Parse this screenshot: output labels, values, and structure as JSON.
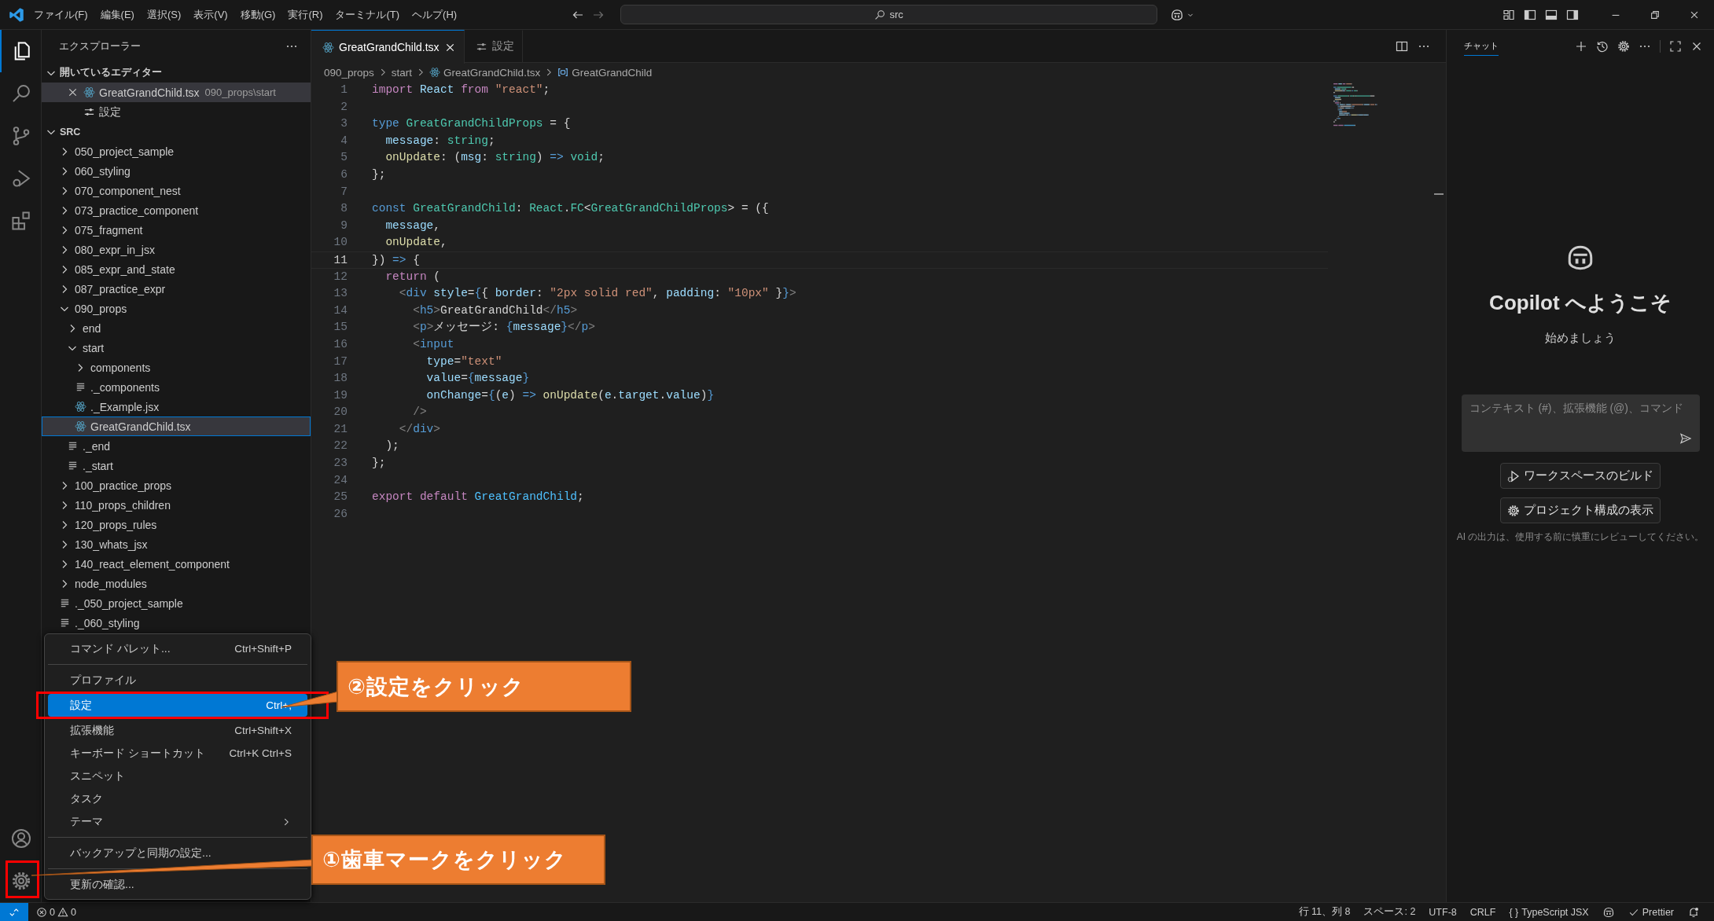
{
  "title_bar": {
    "menus": [
      "ファイル(F)",
      "編集(E)",
      "選択(S)",
      "表示(V)",
      "移動(G)",
      "実行(R)",
      "ターミナル(T)",
      "ヘルプ(H)"
    ],
    "search": {
      "value": "src"
    }
  },
  "activity_bar": {
    "top": [
      {
        "kind": "explorer",
        "selected": true
      },
      {
        "kind": "search",
        "selected": false
      },
      {
        "kind": "source-control",
        "selected": false
      },
      {
        "kind": "run-debug",
        "selected": false
      },
      {
        "kind": "extensions",
        "selected": false
      }
    ],
    "bottom": [
      {
        "kind": "account"
      },
      {
        "kind": "settings"
      }
    ]
  },
  "explorer": {
    "title": "エクスプローラー",
    "sections": [
      {
        "label": "開いているエディター",
        "expanded": true,
        "items": [
          {
            "label": "GreatGrandChild.tsx",
            "description": "090_props\\start",
            "kind": "react",
            "selected": true
          },
          {
            "label": "設定",
            "kind": "settings",
            "selected": false
          }
        ]
      },
      {
        "label": "SRC",
        "expanded": true,
        "items": [
          {
            "label": "050_project_sample",
            "kind": "folder",
            "expanded": false,
            "selected": false
          },
          {
            "label": "060_styling",
            "kind": "folder",
            "expanded": false,
            "selected": false
          },
          {
            "label": "070_component_nest",
            "kind": "folder",
            "expanded": false,
            "selected": false
          },
          {
            "label": "073_practice_component",
            "kind": "folder",
            "expanded": false,
            "selected": false
          },
          {
            "label": "075_fragment",
            "kind": "folder",
            "expanded": false,
            "selected": false
          },
          {
            "label": "080_expr_in_jsx",
            "kind": "folder",
            "expanded": false,
            "selected": false
          },
          {
            "label": "085_expr_and_state",
            "kind": "folder",
            "expanded": false,
            "selected": false
          },
          {
            "label": "087_practice_expr",
            "kind": "folder",
            "expanded": false,
            "selected": false
          },
          {
            "label": "090_props",
            "kind": "folder",
            "expanded": true,
            "selected": false,
            "children": [
              {
                "label": "end",
                "kind": "folder",
                "expanded": false,
                "selected": false
              },
              {
                "label": "start",
                "kind": "folder",
                "expanded": true,
                "selected": false,
                "children": [
                  {
                    "label": "components",
                    "kind": "folder",
                    "expanded": false,
                    "selected": false
                  },
                  {
                    "label": "._components",
                    "kind": "text",
                    "selected": false
                  },
                  {
                    "label": "._Example.jsx",
                    "kind": "react",
                    "selected": false
                  },
                  {
                    "label": "GreatGrandChild.tsx",
                    "kind": "react",
                    "selected": true
                  }
                ]
              },
              {
                "label": "._end",
                "kind": "text",
                "selected": false
              },
              {
                "label": "._start",
                "kind": "text",
                "selected": false
              }
            ]
          },
          {
            "label": "100_practice_props",
            "kind": "folder",
            "expanded": false,
            "selected": false
          },
          {
            "label": "110_props_children",
            "kind": "folder",
            "expanded": false,
            "selected": false
          },
          {
            "label": "120_props_rules",
            "kind": "folder",
            "expanded": false,
            "selected": false
          },
          {
            "label": "130_whats_jsx",
            "kind": "folder",
            "expanded": false,
            "selected": false
          },
          {
            "label": "140_react_element_component",
            "kind": "folder",
            "expanded": false,
            "selected": false
          },
          {
            "label": "node_modules",
            "kind": "folder",
            "expanded": false,
            "selected": false
          },
          {
            "label": "._050_project_sample",
            "kind": "text",
            "selected": false
          },
          {
            "label": "._060_styling",
            "kind": "text",
            "selected": false
          }
        ]
      }
    ]
  },
  "editor": {
    "tabs": [
      {
        "label": "GreatGrandChild.tsx",
        "kind": "react",
        "selected": true
      },
      {
        "label": "設定",
        "kind": "settings",
        "selected": false
      }
    ],
    "breadcrumb": [
      {
        "label": "090_props",
        "kind": "folder"
      },
      {
        "label": "start",
        "kind": "folder"
      },
      {
        "label": "GreatGrandChild.tsx",
        "kind": "react"
      },
      {
        "label": "GreatGrandChild",
        "kind": "symbol"
      }
    ],
    "lines": [
      {
        "number": "1",
        "current": false,
        "tokens": [
          {
            "kind": "keyword",
            "text": "import "
          },
          {
            "kind": "variable",
            "text": "React "
          },
          {
            "kind": "keyword",
            "text": "from "
          },
          {
            "kind": "string",
            "text": "\"react\""
          },
          {
            "kind": "plain",
            "text": ";"
          }
        ]
      },
      {
        "number": "2",
        "current": false
      },
      {
        "number": "3",
        "current": false,
        "tokens": [
          {
            "kind": "storage",
            "text": "type "
          },
          {
            "kind": "type",
            "text": "GreatGrandChildProps "
          },
          {
            "kind": "plain",
            "text": "= {"
          }
        ]
      },
      {
        "number": "4",
        "current": false,
        "tokens": [
          {
            "kind": "variable",
            "text": "  message"
          },
          {
            "kind": "plain",
            "text": ": "
          },
          {
            "kind": "type",
            "text": "string"
          },
          {
            "kind": "plain",
            "text": ";"
          }
        ]
      },
      {
        "number": "5",
        "current": false,
        "tokens": [
          {
            "kind": "function",
            "text": "  onUpdate"
          },
          {
            "kind": "plain",
            "text": ": ("
          },
          {
            "kind": "variable",
            "text": "msg"
          },
          {
            "kind": "plain",
            "text": ": "
          },
          {
            "kind": "type",
            "text": "string"
          },
          {
            "kind": "plain",
            "text": ") "
          },
          {
            "kind": "storage",
            "text": "=> "
          },
          {
            "kind": "type",
            "text": "void"
          },
          {
            "kind": "plain",
            "text": ";"
          }
        ]
      },
      {
        "number": "6",
        "current": false,
        "tokens": [
          {
            "kind": "plain",
            "text": "};"
          }
        ]
      },
      {
        "number": "7",
        "current": false
      },
      {
        "number": "8",
        "current": false,
        "tokens": [
          {
            "kind": "storage",
            "text": "const "
          },
          {
            "kind": "type",
            "text": "GreatGrandChild"
          },
          {
            "kind": "plain",
            "text": ": "
          },
          {
            "kind": "type",
            "text": "React"
          },
          {
            "kind": "plain",
            "text": "."
          },
          {
            "kind": "type",
            "text": "FC"
          },
          {
            "kind": "plain",
            "text": "<"
          },
          {
            "kind": "type",
            "text": "GreatGrandChildProps"
          },
          {
            "kind": "plain",
            "text": "> = ({"
          }
        ]
      },
      {
        "number": "9",
        "current": false,
        "tokens": [
          {
            "kind": "variable",
            "text": "  message"
          },
          {
            "kind": "plain",
            "text": ","
          }
        ]
      },
      {
        "number": "10",
        "current": false,
        "tokens": [
          {
            "kind": "function",
            "text": "  onUpdate"
          },
          {
            "kind": "plain",
            "text": ","
          }
        ]
      },
      {
        "number": "11",
        "current": true,
        "tokens": [
          {
            "kind": "plain",
            "text": "}) "
          },
          {
            "kind": "storage",
            "text": "=> "
          },
          {
            "kind": "plain",
            "text": "{"
          }
        ]
      },
      {
        "number": "12",
        "current": false,
        "tokens": [
          {
            "kind": "keyword",
            "text": "  return "
          },
          {
            "kind": "plain",
            "text": "("
          }
        ]
      },
      {
        "number": "13",
        "current": false,
        "tokens": [
          {
            "kind": "bracket",
            "text": "    <"
          },
          {
            "kind": "tag",
            "text": "div "
          },
          {
            "kind": "variable",
            "text": "style"
          },
          {
            "kind": "plain",
            "text": "="
          },
          {
            "kind": "brace",
            "text": "{"
          },
          {
            "kind": "plain",
            "text": "{ "
          },
          {
            "kind": "variable",
            "text": "border"
          },
          {
            "kind": "plain",
            "text": ": "
          },
          {
            "kind": "string",
            "text": "\"2px solid red\""
          },
          {
            "kind": "plain",
            "text": ", "
          },
          {
            "kind": "variable",
            "text": "padding"
          },
          {
            "kind": "plain",
            "text": ": "
          },
          {
            "kind": "string",
            "text": "\"10px\""
          },
          {
            "kind": "plain",
            "text": " }"
          },
          {
            "kind": "brace",
            "text": "}"
          },
          {
            "kind": "bracket",
            "text": ">"
          }
        ]
      },
      {
        "number": "14",
        "current": false,
        "tokens": [
          {
            "kind": "bracket",
            "text": "      <"
          },
          {
            "kind": "tag",
            "text": "h5"
          },
          {
            "kind": "bracket",
            "text": ">"
          },
          {
            "kind": "plain",
            "text": "GreatGrandChild"
          },
          {
            "kind": "bracket",
            "text": "</"
          },
          {
            "kind": "tag",
            "text": "h5"
          },
          {
            "kind": "bracket",
            "text": ">"
          }
        ]
      },
      {
        "number": "15",
        "current": false,
        "tokens": [
          {
            "kind": "bracket",
            "text": "      <"
          },
          {
            "kind": "tag",
            "text": "p"
          },
          {
            "kind": "bracket",
            "text": ">"
          },
          {
            "kind": "plain",
            "text": "メッセージ: "
          },
          {
            "kind": "brace",
            "text": "{"
          },
          {
            "kind": "variable",
            "text": "message"
          },
          {
            "kind": "brace",
            "text": "}"
          },
          {
            "kind": "bracket",
            "text": "</"
          },
          {
            "kind": "tag",
            "text": "p"
          },
          {
            "kind": "bracket",
            "text": ">"
          }
        ]
      },
      {
        "number": "16",
        "current": false,
        "tokens": [
          {
            "kind": "bracket",
            "text": "      <"
          },
          {
            "kind": "tag",
            "text": "input"
          }
        ]
      },
      {
        "number": "17",
        "current": false,
        "tokens": [
          {
            "kind": "variable",
            "text": "        type"
          },
          {
            "kind": "plain",
            "text": "="
          },
          {
            "kind": "string",
            "text": "\"text\""
          }
        ]
      },
      {
        "number": "18",
        "current": false,
        "tokens": [
          {
            "kind": "variable",
            "text": "        value"
          },
          {
            "kind": "plain",
            "text": "="
          },
          {
            "kind": "brace",
            "text": "{"
          },
          {
            "kind": "variable",
            "text": "message"
          },
          {
            "kind": "brace",
            "text": "}"
          }
        ]
      },
      {
        "number": "19",
        "current": false,
        "tokens": [
          {
            "kind": "variable",
            "text": "        onChange"
          },
          {
            "kind": "plain",
            "text": "="
          },
          {
            "kind": "brace",
            "text": "{"
          },
          {
            "kind": "plain",
            "text": "("
          },
          {
            "kind": "variable",
            "text": "e"
          },
          {
            "kind": "plain",
            "text": ") "
          },
          {
            "kind": "storage",
            "text": "=> "
          },
          {
            "kind": "function",
            "text": "onUpdate"
          },
          {
            "kind": "plain",
            "text": "("
          },
          {
            "kind": "variable",
            "text": "e"
          },
          {
            "kind": "plain",
            "text": "."
          },
          {
            "kind": "variable",
            "text": "target"
          },
          {
            "kind": "plain",
            "text": "."
          },
          {
            "kind": "variable",
            "text": "value"
          },
          {
            "kind": "plain",
            "text": ")"
          },
          {
            "kind": "brace",
            "text": "}"
          }
        ]
      },
      {
        "number": "20",
        "current": false,
        "tokens": [
          {
            "kind": "bracket",
            "text": "      />"
          }
        ]
      },
      {
        "number": "21",
        "current": false,
        "tokens": [
          {
            "kind": "bracket",
            "text": "    </"
          },
          {
            "kind": "tag",
            "text": "div"
          },
          {
            "kind": "bracket",
            "text": ">"
          }
        ]
      },
      {
        "number": "22",
        "current": false,
        "tokens": [
          {
            "kind": "plain",
            "text": "  );"
          }
        ]
      },
      {
        "number": "23",
        "current": false,
        "tokens": [
          {
            "kind": "plain",
            "text": "};"
          }
        ]
      },
      {
        "number": "24",
        "current": false
      },
      {
        "number": "25",
        "current": false,
        "tokens": [
          {
            "kind": "keyword",
            "text": "export "
          },
          {
            "kind": "keyword",
            "text": "default "
          },
          {
            "kind": "constant",
            "text": "GreatGrandChild"
          },
          {
            "kind": "plain",
            "text": ";"
          }
        ]
      },
      {
        "number": "26",
        "current": false
      }
    ]
  },
  "chat": {
    "tabs": [
      {
        "label": "チャット",
        "selected": true
      }
    ],
    "title": "Copilot へようこそ",
    "subtitle": "始めましょう",
    "input": {
      "placeholder": "コンテキスト (#)、拡張機能 (@)、コマンド"
    },
    "actions": [
      {
        "label": "ワークスペースのビルド",
        "kind": "build"
      },
      {
        "label": "プロジェクト構成の表示",
        "kind": "settings"
      }
    ],
    "disclaimer": "AI の出力は、使用する前に慎重にレビューしてください。"
  },
  "context_menu": {
    "items": [
      {
        "kind": "item",
        "label": "コマンド パレット...",
        "shortcut": "Ctrl+Shift+P",
        "selected": false
      },
      {
        "kind": "separator"
      },
      {
        "kind": "item",
        "label": "プロファイル",
        "selected": false
      },
      {
        "kind": "item",
        "label": "設定",
        "shortcut": "Ctrl+,",
        "selected": true
      },
      {
        "kind": "item",
        "label": "拡張機能",
        "shortcut": "Ctrl+Shift+X",
        "selected": false
      },
      {
        "kind": "item",
        "label": "キーボード ショートカット",
        "shortcut": "Ctrl+K Ctrl+S",
        "selected": false
      },
      {
        "kind": "item",
        "label": "スニペット",
        "selected": false
      },
      {
        "kind": "item",
        "label": "タスク",
        "selected": false
      },
      {
        "kind": "submenu",
        "label": "テーマ",
        "selected": false
      },
      {
        "kind": "separator"
      },
      {
        "kind": "item",
        "label": "バックアップと同期の設定...",
        "selected": false
      },
      {
        "kind": "separator"
      },
      {
        "kind": "item",
        "label": "更新の確認...",
        "selected": false
      }
    ]
  },
  "annotations": [
    {
      "kind": "settings-item",
      "text": "②設定をクリック"
    },
    {
      "kind": "gear-button",
      "text": "①歯車マークをクリック"
    }
  ],
  "status_bar": {
    "errors": "0",
    "warnings": "0",
    "right": [
      {
        "kind": "text",
        "text": "行 11、列 8"
      },
      {
        "kind": "text",
        "text": "スペース: 2"
      },
      {
        "kind": "text",
        "text": "UTF-8"
      },
      {
        "kind": "text",
        "text": "CRLF"
      },
      {
        "kind": "language",
        "icon": "{ }",
        "text": "TypeScript JSX"
      },
      {
        "kind": "copilot"
      },
      {
        "kind": "check",
        "text": "Prettier"
      },
      {
        "kind": "bell"
      }
    ]
  }
}
